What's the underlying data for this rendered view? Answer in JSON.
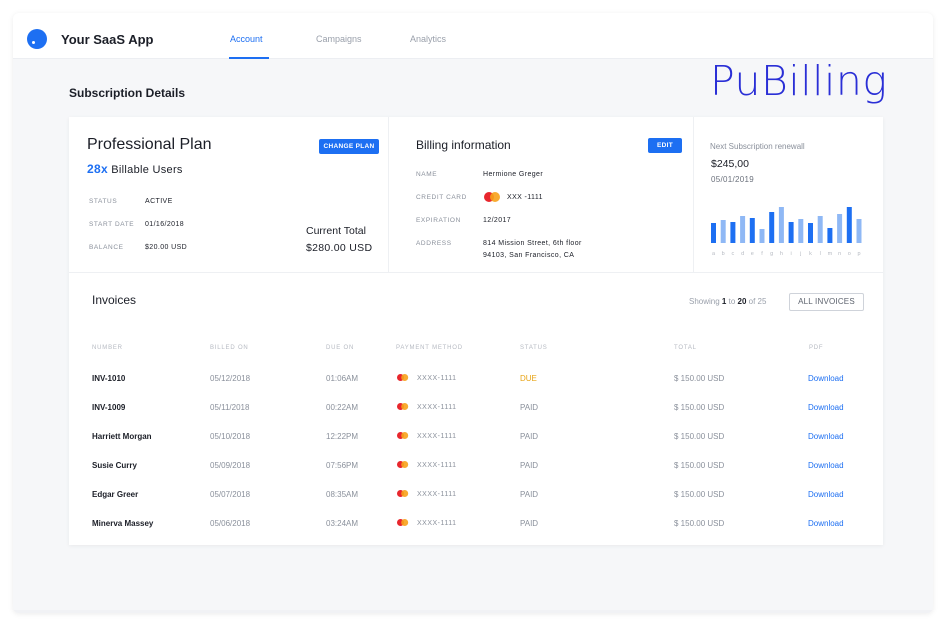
{
  "header": {
    "app_title": "Your SaaS App",
    "tabs": [
      {
        "label": "Account",
        "active": true
      },
      {
        "label": "Campaigns",
        "active": false
      },
      {
        "label": "Analytics",
        "active": false
      }
    ]
  },
  "page": {
    "heading": "Subscription Details",
    "brand_watermark": "PuBilling"
  },
  "plan": {
    "title": "Professional Plan",
    "users_count": "28x",
    "users_label": "Billable Users",
    "change_button": "CHANGE PLAN",
    "status_label": "STATUS",
    "status_value": "ACTIVE",
    "start_label": "START DATE",
    "start_value": "01/16/2018",
    "balance_label": "BALANCE",
    "balance_value": "$20.00 USD",
    "total_label": "Current Total",
    "total_value": "$280.00 USD"
  },
  "billing": {
    "title": "Billing information",
    "edit_button": "EDIT",
    "name_label": "NAME",
    "name_value": "Hermione Greger",
    "card_label": "CREDIT CARD",
    "card_value": "XXX -1111",
    "exp_label": "EXPIRATION",
    "exp_value": "12/2017",
    "address_label": "ADDRESS",
    "address_line1": "814 Mission Street, 6th floor",
    "address_line2": "94103, San Francisco, CA"
  },
  "renewal": {
    "label": "Next Subscription renewall",
    "amount": "$245,00",
    "date": "05/01/2019"
  },
  "chart_data": {
    "type": "bar",
    "categories": [
      "a",
      "b",
      "c",
      "d",
      "e",
      "f",
      "g",
      "h",
      "i",
      "j",
      "k",
      "l",
      "m",
      "n",
      "o",
      "p"
    ],
    "series": [
      {
        "values": [
          20,
          23,
          21,
          27,
          25,
          14,
          31,
          36,
          21,
          24,
          20,
          27,
          15,
          29,
          36,
          24
        ]
      }
    ],
    "ylim": [
      0,
      40
    ],
    "colors": [
      "#1d6ff2",
      "#8fb8f5"
    ]
  },
  "invoices": {
    "title": "Invoices",
    "showing_prefix": "Showing",
    "showing_from": "1",
    "showing_to_word": "to",
    "showing_to": "20",
    "showing_of": "of 25",
    "all_button": "ALL INVOICES",
    "columns": [
      "NUMBER",
      "BILLED ON",
      "DUE ON",
      "PAYMENT METHOD",
      "STATUS",
      "TOTAL",
      "PDF"
    ],
    "rows": [
      {
        "number": "INV-1010",
        "billed": "05/12/2018",
        "due": "01:06AM",
        "payment": "XXXX-1111",
        "status": "DUE",
        "total": "$ 150.00 USD",
        "pdf": "Download"
      },
      {
        "number": "INV-1009",
        "billed": "05/11/2018",
        "due": "00:22AM",
        "payment": "XXXX-1111",
        "status": "PAID",
        "total": "$ 150.00 USD",
        "pdf": "Download"
      },
      {
        "number": "Harriett Morgan",
        "billed": "05/10/2018",
        "due": "12:22PM",
        "payment": "XXXX-1111",
        "status": "PAID",
        "total": "$ 150.00 USD",
        "pdf": "Download"
      },
      {
        "number": "Susie Curry",
        "billed": "05/09/2018",
        "due": "07:56PM",
        "payment": "XXXX-1111",
        "status": "PAID",
        "total": "$ 150.00 USD",
        "pdf": "Download"
      },
      {
        "number": "Edgar Greer",
        "billed": "05/07/2018",
        "due": "08:35AM",
        "payment": "XXXX-1111",
        "status": "PAID",
        "total": "$ 150.00 USD",
        "pdf": "Download"
      },
      {
        "number": "Minerva Massey",
        "billed": "05/06/2018",
        "due": "03:24AM",
        "payment": "XXXX-1111",
        "status": "PAID",
        "total": "$ 150.00 USD",
        "pdf": "Download"
      }
    ]
  }
}
